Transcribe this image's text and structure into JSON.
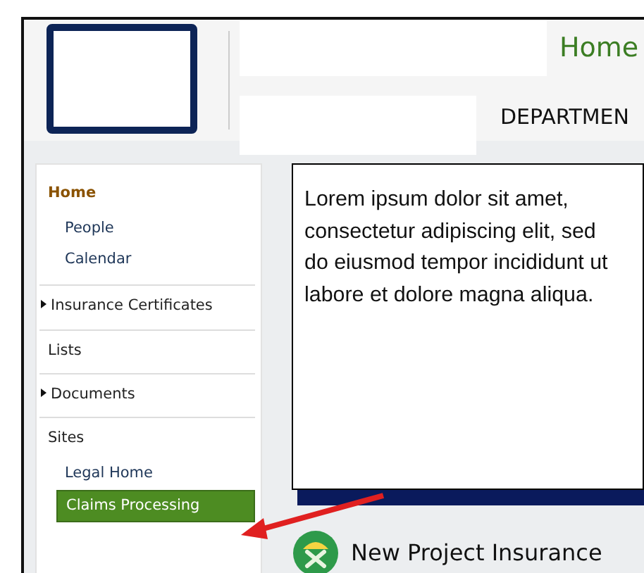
{
  "header": {
    "title": "Home",
    "subtitle": "DEPARTMEN"
  },
  "sidebar": {
    "items": [
      {
        "label": "Home",
        "kind": "heading",
        "expandable": false,
        "selected": false,
        "children": [
          {
            "label": "People",
            "selected": false
          },
          {
            "label": "Calendar",
            "selected": false
          }
        ]
      },
      {
        "label": "Insurance Certificates",
        "kind": "link",
        "expandable": true,
        "selected": false
      },
      {
        "label": "Lists",
        "kind": "link",
        "expandable": false,
        "selected": false
      },
      {
        "label": "Documents",
        "kind": "link",
        "expandable": true,
        "selected": false
      },
      {
        "label": "Sites",
        "kind": "link",
        "expandable": false,
        "selected": false,
        "children": [
          {
            "label": "Legal Home",
            "selected": false
          },
          {
            "label": "Claims Processing",
            "selected": true
          }
        ]
      }
    ]
  },
  "content": {
    "text": "Lorem ipsum dolor sit amet, consectetur adipiscing elit, sed do eiusmod tempor incididunt ut labore et dolore magna aliqua.",
    "link": "New Project Insurance"
  }
}
